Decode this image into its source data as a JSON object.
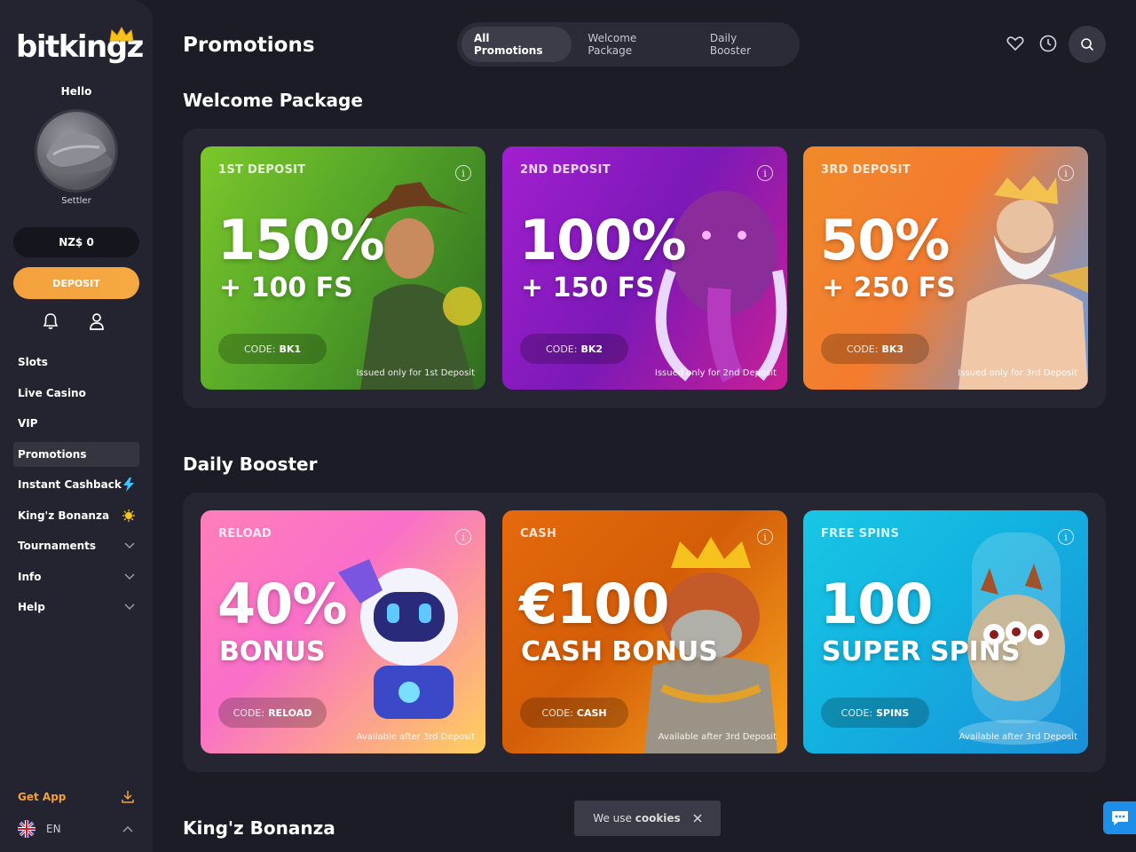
{
  "brand": {
    "logo_text": "bitkingz"
  },
  "sidebar": {
    "greeting": "Hello",
    "rank": "Settler",
    "balance": "NZ$ 0",
    "deposit_label": "DEPOSIT",
    "nav": [
      {
        "label": "Slots"
      },
      {
        "label": "Live Casino"
      },
      {
        "label": "VIP"
      },
      {
        "label": "Promotions"
      },
      {
        "label": "Instant Cashback"
      },
      {
        "label": "King'z Bonanza"
      },
      {
        "label": "Tournaments"
      },
      {
        "label": "Info"
      },
      {
        "label": "Help"
      }
    ],
    "get_app": "Get App",
    "language": "EN"
  },
  "header": {
    "title": "Promotions",
    "tabs": [
      {
        "label": "All Promotions"
      },
      {
        "label": "Welcome Package"
      },
      {
        "label": "Daily Booster"
      }
    ]
  },
  "welcome": {
    "title": "Welcome Package",
    "cards": [
      {
        "label": "1ST DEPOSIT",
        "big": "150%",
        "sub": "+ 100 FS",
        "code_prefix": "CODE:",
        "code": "BK1",
        "note": "Issued only for 1st Deposit"
      },
      {
        "label": "2ND DEPOSIT",
        "big": "100%",
        "sub": "+ 150 FS",
        "code_prefix": "CODE:",
        "code": "BK2",
        "note": "Issued only for 2nd Deposit"
      },
      {
        "label": "3RD DEPOSIT",
        "big": "50%",
        "sub": "+ 250 FS",
        "code_prefix": "CODE:",
        "code": "BK3",
        "note": "Issued only for 3rd Deposit"
      }
    ]
  },
  "booster": {
    "title": "Daily Booster",
    "cards": [
      {
        "label": "RELOAD",
        "big": "40%",
        "sub": "BONUS",
        "code_prefix": "CODE:",
        "code": "RELOAD",
        "note": "Available after 3rd Deposit"
      },
      {
        "label": "CASH",
        "big": "€100",
        "sub": "CASH BONUS",
        "code_prefix": "CODE:",
        "code": "CASH",
        "note": "Available after 3rd Deposit"
      },
      {
        "label": "FREE SPINS",
        "big": "100",
        "sub": "SUPER SPINS",
        "code_prefix": "CODE:",
        "code": "SPINS",
        "note": "Available after 3rd Deposit"
      }
    ]
  },
  "next_section": {
    "title": "King'z Bonanza"
  },
  "cookie": {
    "prefix": "We use",
    "bold": "cookies"
  },
  "colors": {
    "accent": "#f3a13d",
    "background": "#1b1c26",
    "sidebar": "#232430",
    "chat": "#1e8fe8"
  }
}
